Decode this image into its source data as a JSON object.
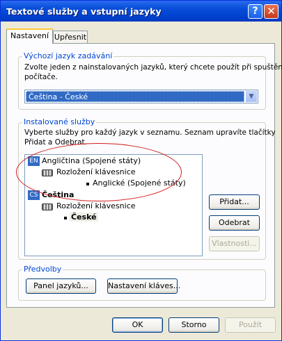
{
  "window": {
    "title": "Textové služby a vstupní jazyky",
    "help_icon": "?",
    "close_icon": "✕"
  },
  "tabs": [
    {
      "label": "Nastavení",
      "active": true
    },
    {
      "label": "Upřesnit",
      "active": false
    }
  ],
  "default_language": {
    "legend": "Výchozí jazyk zadávání",
    "description_line1": "Zvolte jeden z nainstalovaných jazyků, který chcete použít při spuštění",
    "description_line2": "počítače.",
    "selected": "Čeština - České"
  },
  "installed_services": {
    "legend": "Instalované služby",
    "description_line1": "Vyberte služby pro každý jazyk v seznamu. Seznam upravíte tlačítky",
    "description_line2": "Přidat a Odebrat.",
    "tree": [
      {
        "badge": "EN",
        "language": "Angličtina (Spojené státy)",
        "category": "Rozložení klávesnice",
        "layout": "Anglické (Spojené státy)"
      },
      {
        "badge": "CS",
        "language": "Čeština",
        "category": "Rozložení klávesnice",
        "layout": "České"
      }
    ],
    "add_button": "Přidat...",
    "remove_button": "Odebrat",
    "properties_button": "Vlastnosti..."
  },
  "preferences": {
    "legend": "Předvolby",
    "language_bar_button": "Panel jazyků...",
    "key_settings_button": "Nastavení kláves..."
  },
  "footer": {
    "ok_button": "OK",
    "cancel_button": "Storno",
    "apply_button": "Použít"
  },
  "colors": {
    "title_bar": "#0a4fd9",
    "legend_text": "#0046d5",
    "selection": "#316ac5",
    "annotation_ellipse": "#d41c1c"
  }
}
